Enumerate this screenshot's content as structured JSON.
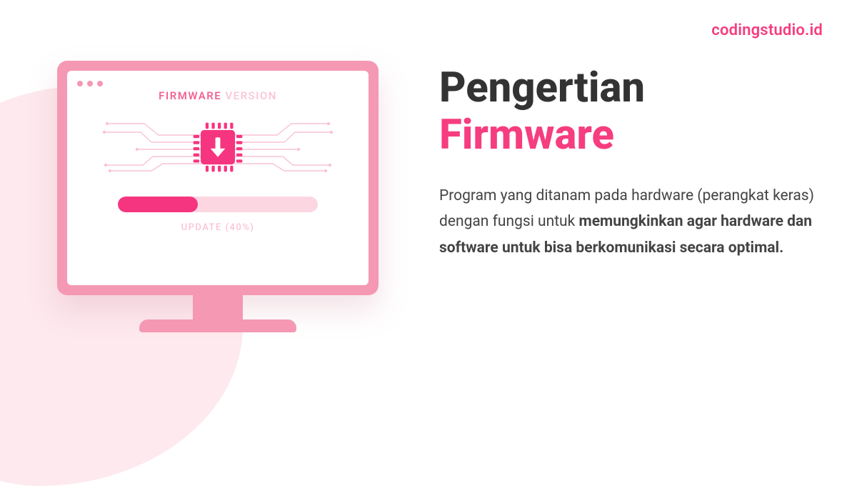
{
  "brand": "codingstudio.id",
  "heading": {
    "line1": "Pengertian",
    "line2": "Firmware"
  },
  "description": {
    "part1": "Program yang ditanam pada hardware (perangkat keras) dengan fungsi untuk ",
    "bold": "memungkinkan agar hardware dan software untuk bisa berkomunikasi secara optimal."
  },
  "monitor": {
    "firmware_label_bold": "FIRMWARE",
    "firmware_label_light": " VERSION",
    "update_label": "UPDATE (40%)",
    "progress_percent": 40
  },
  "colors": {
    "accent": "#f63d7f",
    "accent_dark": "#f63580",
    "frame": "#f498b4",
    "soft": "#fcd7e2",
    "blob": "#fde9ee",
    "text": "#333333"
  }
}
